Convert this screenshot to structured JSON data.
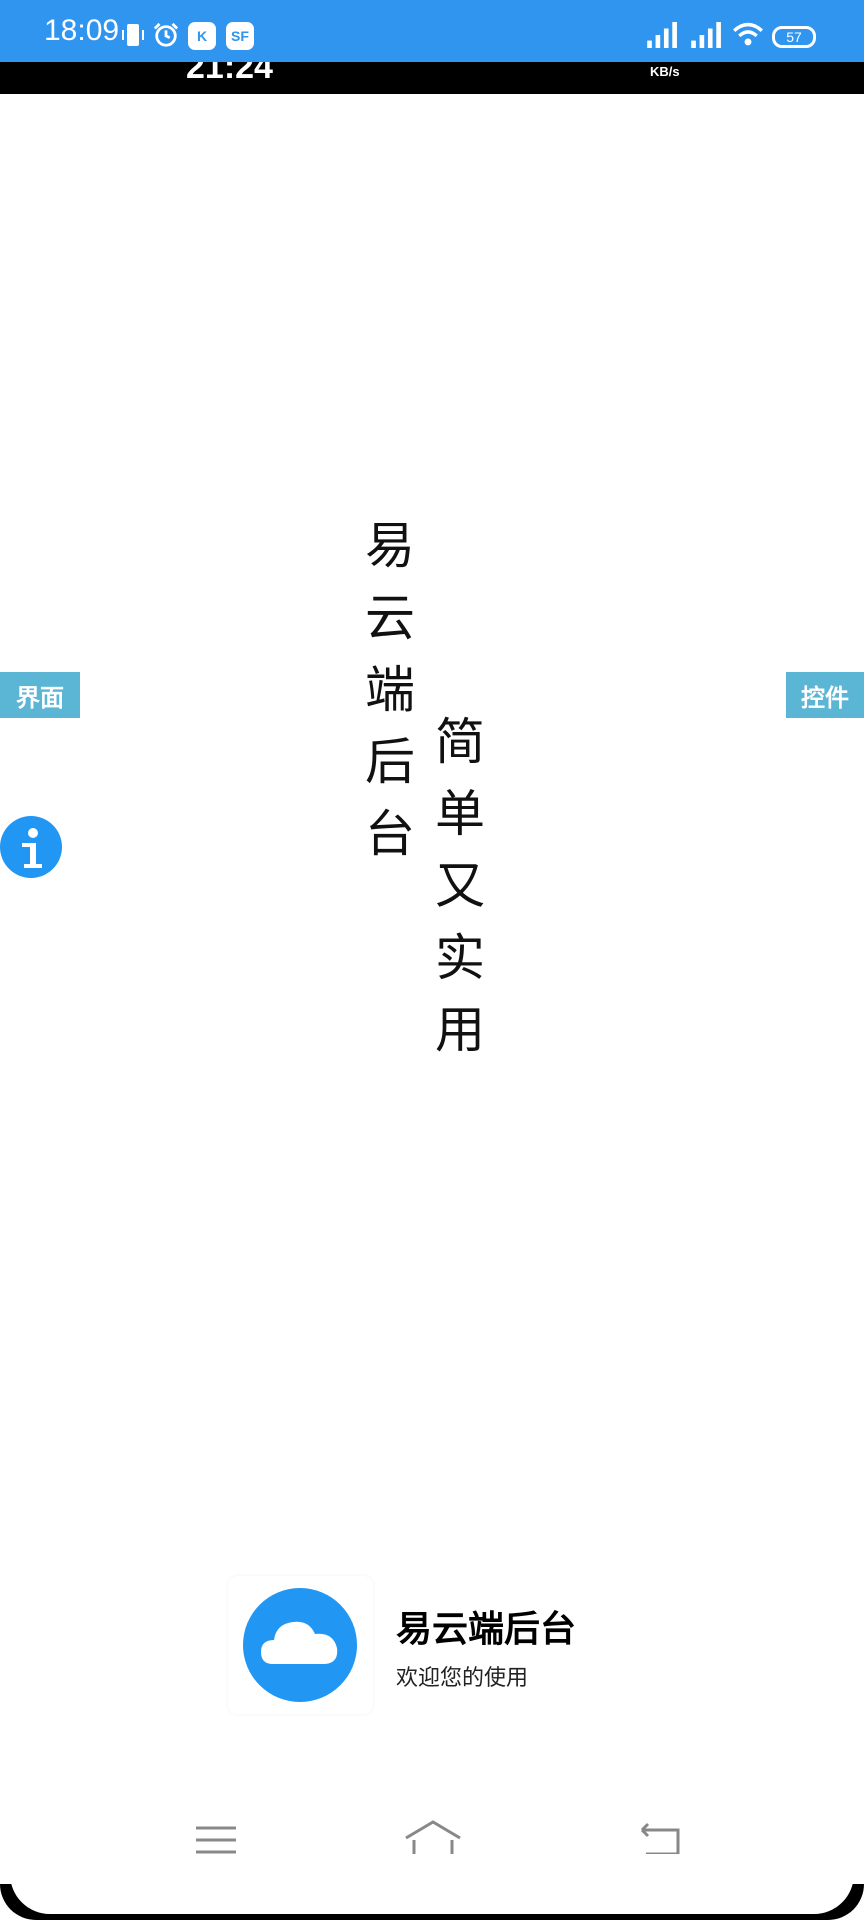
{
  "status_bar": {
    "time": "18:09",
    "badge_k": "K",
    "badge_sf": "SF",
    "battery": "57",
    "colors": {
      "background": "#2f95ef"
    }
  },
  "inner_status_bar": {
    "time": "21:24",
    "speed_unit": "KB/s"
  },
  "side_tabs": {
    "left_label": "界面",
    "right_label": "控件",
    "color": "#5bb6d6"
  },
  "info_button": {
    "icon": "info-icon",
    "color": "#2196f3"
  },
  "poem": {
    "line1": [
      "易",
      "云",
      "端",
      "后",
      "台"
    ],
    "line2": [
      "简",
      "单",
      "又",
      "实",
      "用"
    ]
  },
  "app_card": {
    "icon": "cloud-icon",
    "name": "易云端后台",
    "welcome": "欢迎您的使用",
    "accent": "#2196f3"
  },
  "nav_bar": {
    "menu_icon": "menu-icon",
    "home_icon": "home-icon",
    "back_icon": "back-icon"
  }
}
